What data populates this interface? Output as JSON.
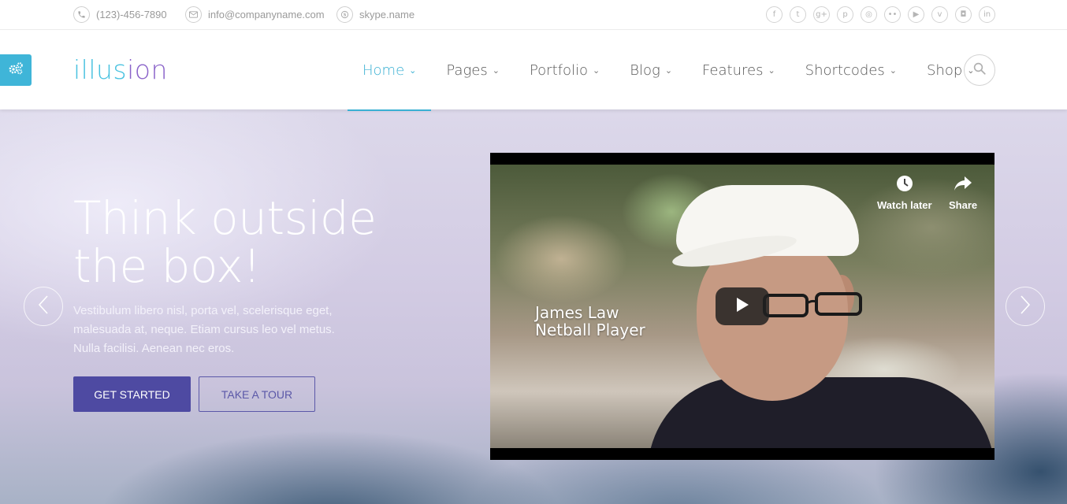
{
  "topbar": {
    "phone": "(123)-456-7890",
    "email": "info@companyname.com",
    "skype": "skype.name",
    "contact_icons": [
      "phone-icon",
      "envelope-icon",
      "skype-icon"
    ],
    "social": [
      {
        "name": "facebook-icon",
        "glyph": "f"
      },
      {
        "name": "twitter-icon",
        "glyph": "t"
      },
      {
        "name": "google-plus-icon",
        "glyph": "g+"
      },
      {
        "name": "pinterest-icon",
        "glyph": "p"
      },
      {
        "name": "dribbble-icon",
        "glyph": "◎"
      },
      {
        "name": "flickr-icon",
        "glyph": "••"
      },
      {
        "name": "youtube-icon",
        "glyph": "▶"
      },
      {
        "name": "vimeo-icon",
        "glyph": "v"
      },
      {
        "name": "instagram-icon",
        "glyph": "◘"
      },
      {
        "name": "linkedin-icon",
        "glyph": "in"
      }
    ]
  },
  "header": {
    "logo_part1": "illus",
    "logo_part2": "ion",
    "nav": [
      {
        "label": "Home",
        "active": true
      },
      {
        "label": "Pages",
        "active": false
      },
      {
        "label": "Portfolio",
        "active": false
      },
      {
        "label": "Blog",
        "active": false
      },
      {
        "label": "Features",
        "active": false
      },
      {
        "label": "Shortcodes",
        "active": false
      },
      {
        "label": "Shop",
        "active": false
      }
    ],
    "chevron": "⌄"
  },
  "hero": {
    "headline_line1": "Think outside",
    "headline_line2": "the box!",
    "subtext": "Vestibulum libero nisl, porta vel, scelerisque eget, malesuada at, neque. Etiam cursus leo vel metus. Nulla facilisi. Aenean nec eros.",
    "primary_button": "GET STARTED",
    "secondary_button": "TAKE A TOUR"
  },
  "video": {
    "caption_line1": "James Law",
    "caption_line2": "Netball Player",
    "watch_later": "Watch later",
    "share": "Share"
  },
  "colors": {
    "accent": "#3ab0d3",
    "primary_button": "#4e4aa2",
    "logo_blue": "#49c2e0",
    "logo_purple": "#8a63c9"
  }
}
